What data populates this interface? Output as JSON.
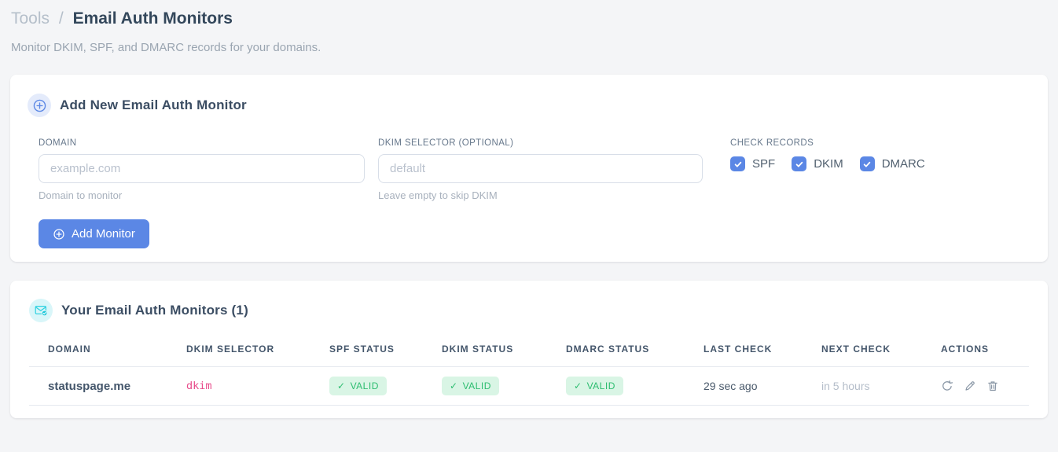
{
  "page": {
    "breadcrumb": {
      "section": "Tools",
      "separator": "/"
    },
    "title": "Email Auth Monitors",
    "subtitle": "Monitor DKIM, SPF, and DMARC records for your domains."
  },
  "add_card": {
    "title": "Add New Email Auth Monitor",
    "fields": {
      "domain": {
        "label": "DOMAIN",
        "placeholder": "example.com",
        "value": "",
        "hint": "Domain to monitor"
      },
      "dkim_selector": {
        "label": "DKIM SELECTOR (OPTIONAL)",
        "placeholder": "default",
        "value": "",
        "hint": "Leave empty to skip DKIM"
      }
    },
    "check_records": {
      "label": "CHECK RECORDS",
      "options": [
        {
          "label": "SPF",
          "checked": true
        },
        {
          "label": "DKIM",
          "checked": true
        },
        {
          "label": "DMARC",
          "checked": true
        }
      ]
    },
    "submit_label": "Add Monitor"
  },
  "monitors_card": {
    "title": "Your Email Auth Monitors (1)",
    "count": 1,
    "table": {
      "headers": [
        "DOMAIN",
        "DKIM SELECTOR",
        "SPF STATUS",
        "DKIM STATUS",
        "DMARC STATUS",
        "LAST CHECK",
        "NEXT CHECK",
        "ACTIONS"
      ],
      "rows": [
        {
          "domain": "statuspage.me",
          "dkim_selector": "dkim",
          "spf_status": "VALID",
          "dkim_status": "VALID",
          "dmarc_status": "VALID",
          "last_check": "29 sec ago",
          "next_check": "in 5 hours",
          "actions": [
            "refresh-icon",
            "edit-icon",
            "delete-icon"
          ]
        }
      ]
    }
  },
  "icons": {
    "check": "✓",
    "plus_circle": "⊕",
    "envelope_check": "✉",
    "refresh": "↻",
    "edit": "✎",
    "delete": "🗑"
  },
  "colors": {
    "accent_blue": "#5b87e5",
    "accent_blue_bg": "#e4ebfb",
    "accent_cyan": "#2ad0e0",
    "accent_cyan_bg": "#d9f6f9",
    "valid_text": "#2dbd70",
    "valid_bg": "#d9f5e5",
    "selector_pink": "#e84c8b",
    "page_bg": "#f4f5f7",
    "card_bg": "#ffffff"
  }
}
